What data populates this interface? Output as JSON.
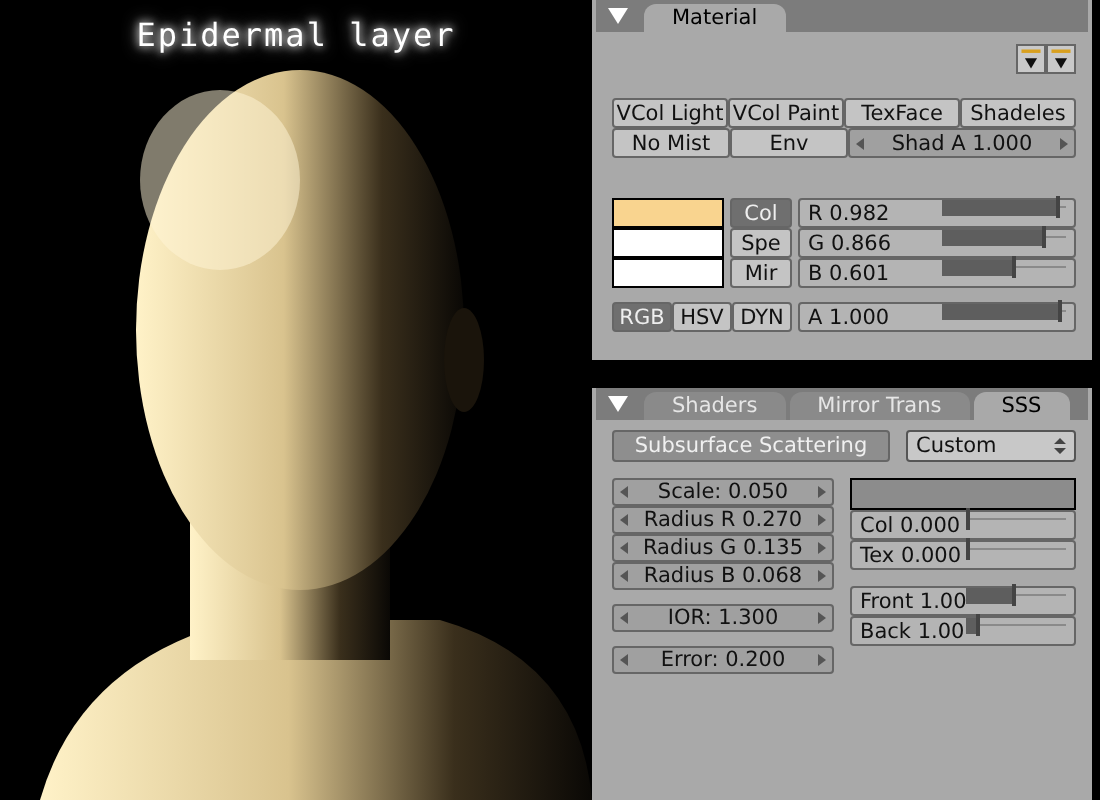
{
  "render": {
    "caption": "Epidermal layer"
  },
  "material_panel": {
    "tabs": [
      {
        "label": "Material",
        "selected": true
      }
    ],
    "buttons": [
      {
        "kind": "toggle",
        "label": "VCol Light"
      },
      {
        "kind": "toggle",
        "label": "VCol Paint"
      },
      {
        "kind": "toggle",
        "label": "TexFace"
      },
      {
        "kind": "toggle",
        "label": "Shadeles"
      },
      {
        "kind": "toggle",
        "label": "No Mist"
      },
      {
        "kind": "toggle",
        "label": "Env"
      },
      {
        "kind": "number",
        "label": "Shad A 1.000"
      }
    ],
    "swatches": [
      {
        "label": "Col",
        "color": "#f9d48f",
        "selected": true
      },
      {
        "label": "Spe",
        "color": "#ffffff",
        "selected": false
      },
      {
        "label": "Mir",
        "color": "#ffffff",
        "selected": false
      }
    ],
    "color_sliders": [
      {
        "label": "R 0.982",
        "level": 0.982
      },
      {
        "label": "G 0.866",
        "level": 0.866
      },
      {
        "label": "B 0.601",
        "level": 0.601
      }
    ],
    "color_modes": [
      {
        "label": "RGB",
        "selected": true
      },
      {
        "label": "HSV",
        "selected": false
      },
      {
        "label": "DYN",
        "selected": false
      }
    ],
    "alpha": {
      "label": "A 1.000",
      "level": 1.0
    }
  },
  "sss_panel": {
    "tabs": [
      {
        "label": "Shaders",
        "selected": false
      },
      {
        "label": "Mirror Trans",
        "selected": false
      },
      {
        "label": "SSS",
        "selected": true
      }
    ],
    "toggle": {
      "label": "Subsurface Scattering"
    },
    "preset": {
      "value": "Custom"
    },
    "number_groups": [
      [
        "Scale: 0.050",
        "Radius R 0.270",
        "Radius G 0.135",
        "Radius B 0.068"
      ],
      [
        "IOR: 1.300"
      ],
      [
        "Error: 0.200"
      ]
    ],
    "swatch": {
      "color": "#8c8c8c"
    },
    "slider_groups": [
      [
        {
          "label": "Col 0.000",
          "level": 0.0
        },
        {
          "label": "Tex 0.000",
          "level": 0.0
        }
      ],
      [
        {
          "label": "Front 1.00",
          "level": 0.5
        },
        {
          "label": "Back 1.00",
          "level": 0.1
        }
      ]
    ]
  }
}
